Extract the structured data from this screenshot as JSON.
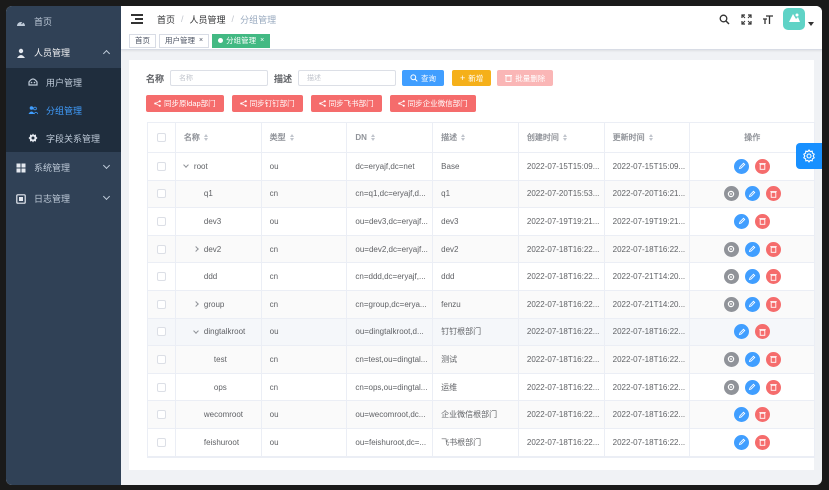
{
  "sidebar": {
    "items": [
      {
        "label": "首页",
        "icon": "dashboard-icon"
      },
      {
        "label": "人员管理",
        "icon": "user-icon",
        "expanded": true
      },
      {
        "label": "系统管理",
        "icon": "grid-icon"
      },
      {
        "label": "日志管理",
        "icon": "log-icon"
      }
    ],
    "subitems": [
      {
        "label": "用户管理",
        "icon": "user-manage-icon"
      },
      {
        "label": "分组管理",
        "icon": "group-icon",
        "active": true
      },
      {
        "label": "字段关系管理",
        "icon": "field-relation-icon"
      }
    ]
  },
  "breadcrumb": [
    "首页",
    "人员管理",
    "分组管理"
  ],
  "tags": [
    {
      "label": "首页"
    },
    {
      "label": "用户管理",
      "close": "×"
    },
    {
      "label": "分组管理",
      "close": "×",
      "active": true
    }
  ],
  "search": {
    "name_label": "名称",
    "name_placeholder": "名称",
    "desc_label": "描述",
    "desc_placeholder": "描述",
    "query_label": "查询",
    "add_label": "新增",
    "batch_delete_label": "批量删除"
  },
  "sync_buttons": [
    "同步原ldap部门",
    "同步钉钉部门",
    "同步飞书部门",
    "同步企业微信部门"
  ],
  "table": {
    "headers": [
      "名称",
      "类型",
      "DN",
      "描述",
      "创建时间",
      "更新时间",
      "操作"
    ],
    "rows": [
      {
        "name": "root",
        "type": "ou",
        "dn": "dc=eryajf,dc=net",
        "desc": "Base",
        "created": "2022-07-15T15:09...",
        "updated": "2022-07-15T15:09...",
        "level": 0,
        "toggle": "down",
        "ops": [
          "edit",
          "delete"
        ]
      },
      {
        "name": "q1",
        "type": "cn",
        "dn": "cn=q1,dc=eryajf,d...",
        "desc": "q1",
        "created": "2022-07-20T15:53...",
        "updated": "2022-07-20T16:21...",
        "level": 1,
        "toggle": "none",
        "ops": [
          "setting",
          "edit",
          "delete"
        ]
      },
      {
        "name": "dev3",
        "type": "ou",
        "dn": "ou=dev3,dc=eryajf...",
        "desc": "dev3",
        "created": "2022-07-19T19:21...",
        "updated": "2022-07-19T19:21...",
        "level": 1,
        "toggle": "none",
        "ops": [
          "edit",
          "delete"
        ]
      },
      {
        "name": "dev2",
        "type": "cn",
        "dn": "ou=dev2,dc=eryajf...",
        "desc": "dev2",
        "created": "2022-07-18T16:22...",
        "updated": "2022-07-18T16:22...",
        "level": 1,
        "toggle": "right",
        "ops": [
          "setting",
          "edit",
          "delete"
        ]
      },
      {
        "name": "ddd",
        "type": "cn",
        "dn": "cn=ddd,dc=eryajf,...",
        "desc": "ddd",
        "created": "2022-07-18T16:22...",
        "updated": "2022-07-21T14:20...",
        "level": 1,
        "toggle": "none",
        "ops": [
          "setting",
          "edit",
          "delete"
        ]
      },
      {
        "name": "group",
        "type": "cn",
        "dn": "cn=group,dc=erya...",
        "desc": "fenzu",
        "created": "2022-07-18T16:22...",
        "updated": "2022-07-21T14:20...",
        "level": 1,
        "toggle": "right",
        "ops": [
          "setting",
          "edit",
          "delete"
        ]
      },
      {
        "name": "dingtalkroot",
        "type": "ou",
        "dn": "ou=dingtalkroot,d...",
        "desc": "钉钉根部门",
        "created": "2022-07-18T16:22...",
        "updated": "2022-07-18T16:22...",
        "level": 1,
        "toggle": "down",
        "ops": [
          "edit",
          "delete"
        ],
        "highlight": true
      },
      {
        "name": "test",
        "type": "cn",
        "dn": "cn=test,ou=dingtal...",
        "desc": "测试",
        "created": "2022-07-18T16:22...",
        "updated": "2022-07-18T16:22...",
        "level": 2,
        "toggle": "none",
        "ops": [
          "setting",
          "edit",
          "delete"
        ]
      },
      {
        "name": "ops",
        "type": "cn",
        "dn": "cn=ops,ou=dingtal...",
        "desc": "运维",
        "created": "2022-07-18T16:22...",
        "updated": "2022-07-18T16:22...",
        "level": 2,
        "toggle": "none",
        "ops": [
          "setting",
          "edit",
          "delete"
        ]
      },
      {
        "name": "wecomroot",
        "type": "ou",
        "dn": "ou=wecomroot,dc...",
        "desc": "企业微信根部门",
        "created": "2022-07-18T16:22...",
        "updated": "2022-07-18T16:22...",
        "level": 1,
        "toggle": "none",
        "ops": [
          "edit",
          "delete"
        ]
      },
      {
        "name": "feishuroot",
        "type": "ou",
        "dn": "ou=feishuroot,dc=...",
        "desc": "飞书根部门",
        "created": "2022-07-18T16:22...",
        "updated": "2022-07-18T16:22...",
        "level": 1,
        "toggle": "none",
        "ops": [
          "edit",
          "delete"
        ]
      }
    ]
  },
  "colors": {
    "sidebar_bg": "#304156",
    "primary": "#409eff",
    "danger": "#f56c6c",
    "warning": "#f5b01a",
    "tag_active": "#42b983"
  }
}
